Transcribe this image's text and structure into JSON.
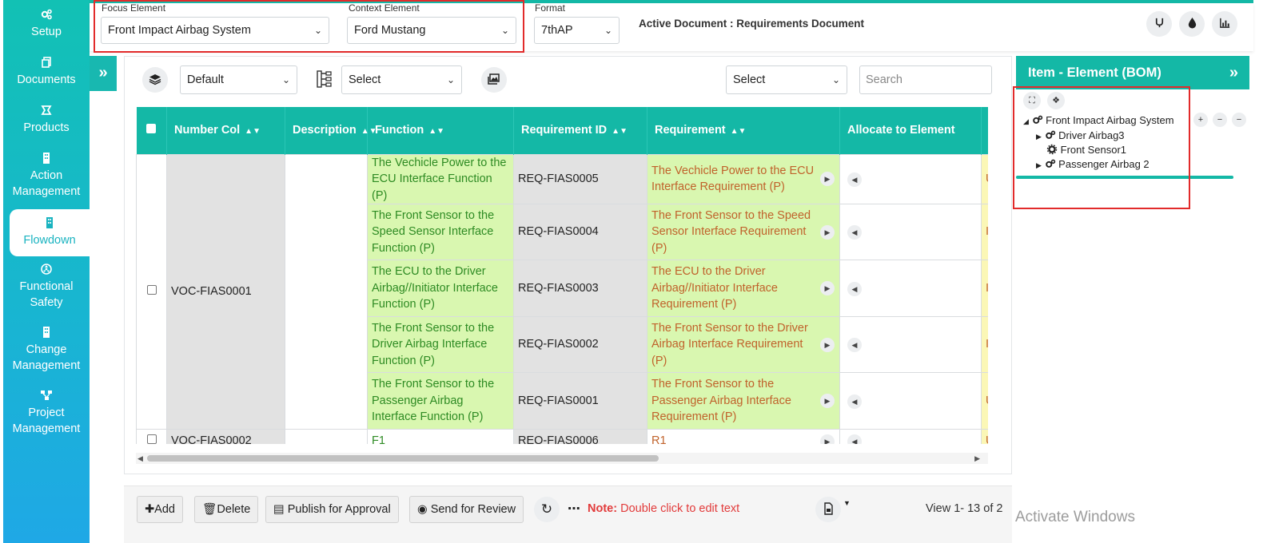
{
  "nav": [
    {
      "label": "Setup",
      "icon": "gears-icon"
    },
    {
      "label": "Documents",
      "icon": "copy-icon"
    },
    {
      "label": "Products",
      "icon": "product-icon"
    },
    {
      "label": "Action Management",
      "icon": "building-icon"
    },
    {
      "label": "Flowdown",
      "icon": "building-icon",
      "active": true
    },
    {
      "label": "Functional Safety",
      "icon": "radiation-icon"
    },
    {
      "label": "Change Management",
      "icon": "building-icon"
    },
    {
      "label": "Project Management",
      "icon": "sitemap-icon"
    }
  ],
  "topbar": {
    "focus_label": "Focus Element",
    "focus_value": "Front Impact Airbag System",
    "context_label": "Context Element",
    "context_value": "Ford Mustang",
    "format_label": "Format",
    "format_value": "7thAP",
    "active_doc": "Active Document : Requirements Document"
  },
  "toolbar": {
    "view_select": "Default",
    "hierarchy_select": "Select",
    "right_select": "Select",
    "search_placeholder": "Search"
  },
  "columns": [
    "Number Col",
    "Description",
    "Function",
    "Requirement ID",
    "Requirement",
    "Allocate to Element"
  ],
  "rows": [
    {
      "function": "The Vechicle Power to the ECU Interface Function (P)",
      "req_id": "REQ-FIAS0005",
      "requirement": "The Vechicle Power to the ECU Interface Requirement (P)",
      "extra": "U"
    },
    {
      "function": "The Front Sensor to the Speed Sensor Interface Function (P)",
      "req_id": "REQ-FIAS0004",
      "requirement": "The Front Sensor to the Speed Sensor Interface Requirement (P)",
      "extra": "I"
    },
    {
      "function": "The ECU to the Driver Airbag//Initiator Interface Function (P)",
      "req_id": "REQ-FIAS0003",
      "requirement": "The ECU to the Driver Airbag//Initiator Interface Requirement (P)",
      "extra": "I"
    },
    {
      "function": "The Front Sensor to the Driver Airbag Interface Function (P)",
      "req_id": "REQ-FIAS0002",
      "requirement": "The Front Sensor to the Driver Airbag Interface Requirement (P)",
      "extra": "I"
    },
    {
      "function": "The Front Sensor to the Passenger Airbag Interface Function (P)",
      "req_id": "REQ-FIAS0001",
      "requirement": "The Front Sensor to the Passenger Airbag Interface Requirement (P)",
      "extra": "U"
    }
  ],
  "group1_number": "VOC-FIAS0001",
  "row2": {
    "number": "VOC-FIAS0002",
    "function": "F1",
    "req_id": "REQ-FIAS0006",
    "requirement": "R1",
    "extra": "U"
  },
  "footer": {
    "add": "Add",
    "delete": "Delete",
    "publish": "Publish for Approval",
    "review": "Send for Review",
    "note_label": "Note:",
    "note_text": "Double click to edit text",
    "view_info": "View 1- 13 of 2"
  },
  "right_panel": {
    "title": "Item - Element (BOM)",
    "tree": [
      "Front Impact Airbag System",
      "Driver Airbag3",
      "Front Sensor1",
      "Passenger Airbag 2"
    ]
  },
  "watermark": "Activate Windows"
}
